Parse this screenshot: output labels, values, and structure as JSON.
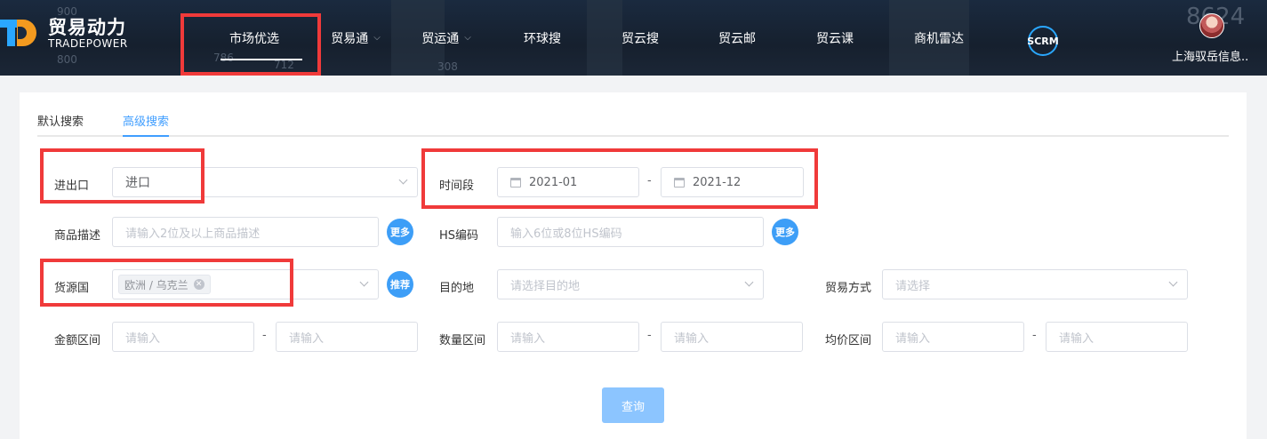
{
  "header": {
    "logo_cn": "贸易动力",
    "logo_en": "TRADEPOWER",
    "bg_numbers": [
      "900",
      "800",
      "786",
      "712",
      "308",
      "8624"
    ],
    "menu": [
      {
        "label": "市场优选",
        "active": true
      },
      {
        "label": "贸易通",
        "dropdown": true
      },
      {
        "label": "贸运通",
        "dropdown": true
      },
      {
        "label": "环球搜"
      },
      {
        "label": "贸云搜"
      },
      {
        "label": "贸云邮"
      },
      {
        "label": "贸云课"
      },
      {
        "label": "商机雷达"
      }
    ],
    "scrm": "SCRM",
    "user": "上海驭岳信息.."
  },
  "tabs": [
    "默认搜索",
    "高级搜索"
  ],
  "form": {
    "import_export": {
      "label": "进出口",
      "value": "进口"
    },
    "period": {
      "label": "时间段",
      "start": "2021-01",
      "end": "2021-12",
      "sep": "-"
    },
    "goods": {
      "label": "商品描述",
      "placeholder": "请输入2位及以上商品描述",
      "btn": "更多"
    },
    "hs": {
      "label": "HS编码",
      "placeholder": "输入6位或8位HS编码",
      "btn": "更多"
    },
    "origin": {
      "label": "货源国",
      "tag": "欧洲 / 乌克兰",
      "btn": "推荐"
    },
    "destination": {
      "label": "目的地",
      "placeholder": "请选择目的地"
    },
    "trade_mode": {
      "label": "贸易方式",
      "placeholder": "请选择"
    },
    "amount": {
      "label": "金额区间",
      "min_ph": "请输入",
      "max_ph": "请输入",
      "sep": "-"
    },
    "quantity": {
      "label": "数量区间",
      "min_ph": "请输入",
      "max_ph": "请输入",
      "sep": "-"
    },
    "avg_price": {
      "label": "均价区间",
      "min_ph": "请输入",
      "max_ph": "请输入",
      "sep": "-"
    },
    "query_btn": "查询"
  },
  "colors": {
    "accent": "#409eff",
    "highlight": "#f03a3a",
    "nav_bg": "#1a2a3f"
  }
}
